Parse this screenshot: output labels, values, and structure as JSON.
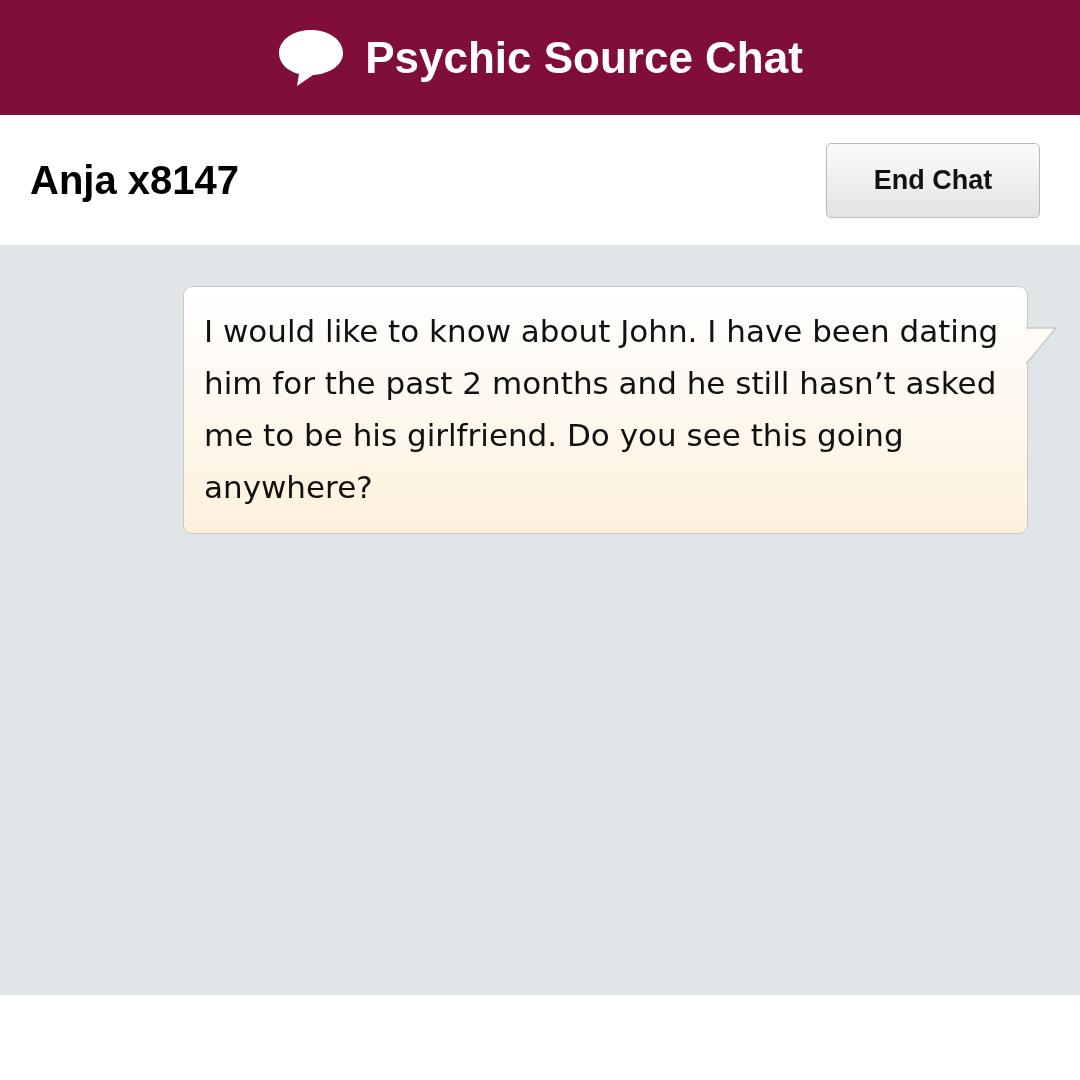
{
  "header": {
    "title": "Psychic Source Chat"
  },
  "chat": {
    "advisor": "Anja x8147",
    "end_button": "End Chat"
  },
  "messages": [
    {
      "kind": "outgoing",
      "text": "I would like to know about John. I have been dating him for the past 2 months and he still hasn’t asked me to be his girlfriend. Do you see this going anywhere?"
    }
  ]
}
